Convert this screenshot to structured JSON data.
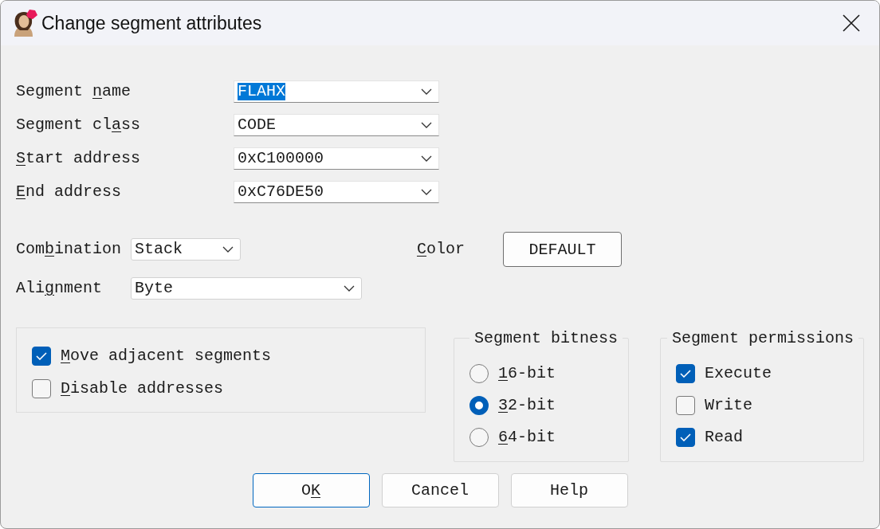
{
  "window": {
    "title": "Change segment attributes"
  },
  "fields": [
    {
      "label_before": "Segment ",
      "access_key": "n",
      "label_after": "ame",
      "value": "FLAHX",
      "highlighted": true
    },
    {
      "label_before": "Segment cl",
      "access_key": "a",
      "label_after": "ss",
      "value": "CODE",
      "highlighted": false
    },
    {
      "access_key": "S",
      "label_after": "tart address",
      "value": "0xC100000",
      "highlighted": false
    },
    {
      "access_key": "E",
      "label_after": "nd address",
      "value": "0xC76DE50",
      "highlighted": false
    }
  ],
  "combination": {
    "label_before": "Com",
    "access_key": "b",
    "label_after": "ination",
    "value": "Stack"
  },
  "color": {
    "access_key": "C",
    "label_after": "olor",
    "button": "DEFAULT"
  },
  "alignment": {
    "label_before": "Ali",
    "access_key": "g",
    "label_after": "nment",
    "value": "Byte"
  },
  "options": [
    {
      "access_key": "M",
      "label_after": "ove adjacent segments",
      "checked": true
    },
    {
      "access_key": "D",
      "label_after": "isable addresses",
      "checked": false
    }
  ],
  "bitness": {
    "title": "Segment bitness",
    "options": [
      {
        "access_key": "1",
        "label_after": "6-bit",
        "selected": false
      },
      {
        "access_key": "3",
        "label_after": "2-bit",
        "selected": true
      },
      {
        "access_key": "6",
        "label_after": "4-bit",
        "selected": false
      }
    ]
  },
  "permissions": {
    "title": "Segment permissions",
    "options": [
      {
        "label": "Execute",
        "checked": true
      },
      {
        "label": "Write",
        "checked": false
      },
      {
        "label": "Read",
        "checked": true
      }
    ]
  },
  "buttons": [
    {
      "label_before": "O",
      "access_key": "K",
      "default": true
    },
    {
      "label": "Cancel",
      "default": false
    },
    {
      "label": "Help",
      "default": false
    }
  ]
}
